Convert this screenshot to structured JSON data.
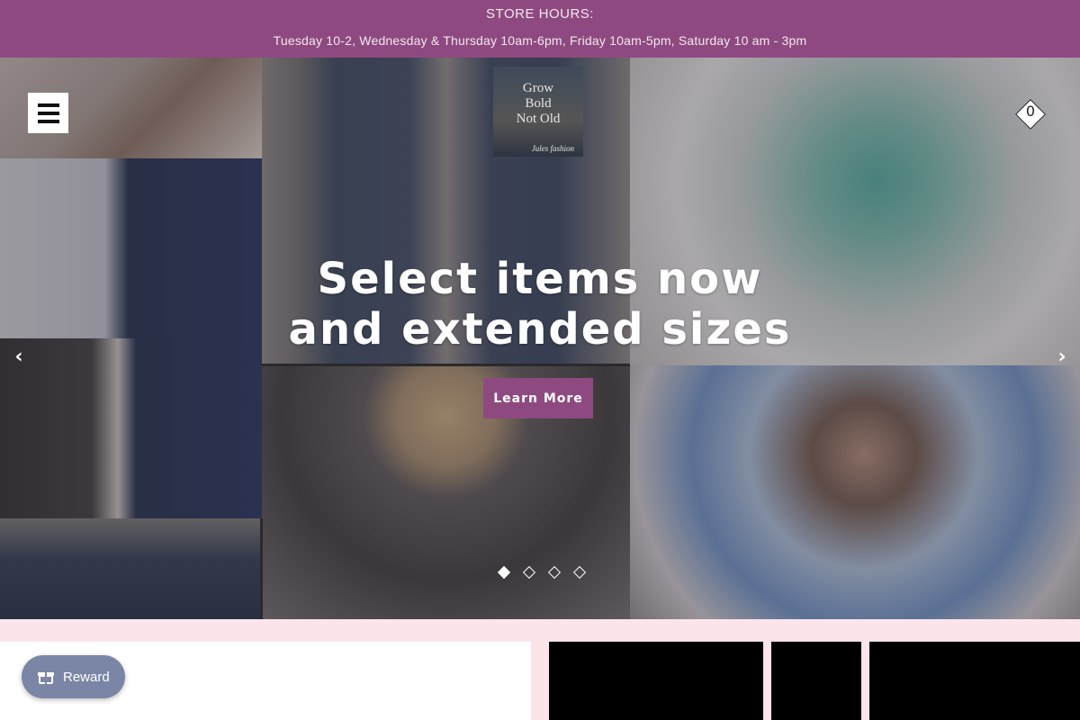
{
  "announcement": {
    "line1": "STORE HOURS:",
    "line2": "Tuesday 10-2, Wednesday & Thursday 10am-6pm, Friday 10am-5pm, Saturday 10 am - 3pm"
  },
  "header": {
    "menu_icon": "hamburger-menu-icon",
    "logo": {
      "text": "Grow Bold Not Old",
      "signature": "Jules fashion"
    },
    "cart": {
      "icon": "diamond-cart-icon",
      "count": "0"
    }
  },
  "hero": {
    "headline": "Select items now and extended sizes",
    "cta_label": "Learn More",
    "prev_icon": "chevron-left-icon",
    "next_icon": "chevron-right-icon",
    "prev_glyph": "‹",
    "next_glyph": "›",
    "slides_total": 4,
    "active_slide": 1
  },
  "reward": {
    "label": "Reward",
    "icon": "gift-icon"
  },
  "colors": {
    "brand_purple": "#8e4a80",
    "page_pink": "#fbe4ea",
    "reward_blue": "#7b86a6"
  }
}
